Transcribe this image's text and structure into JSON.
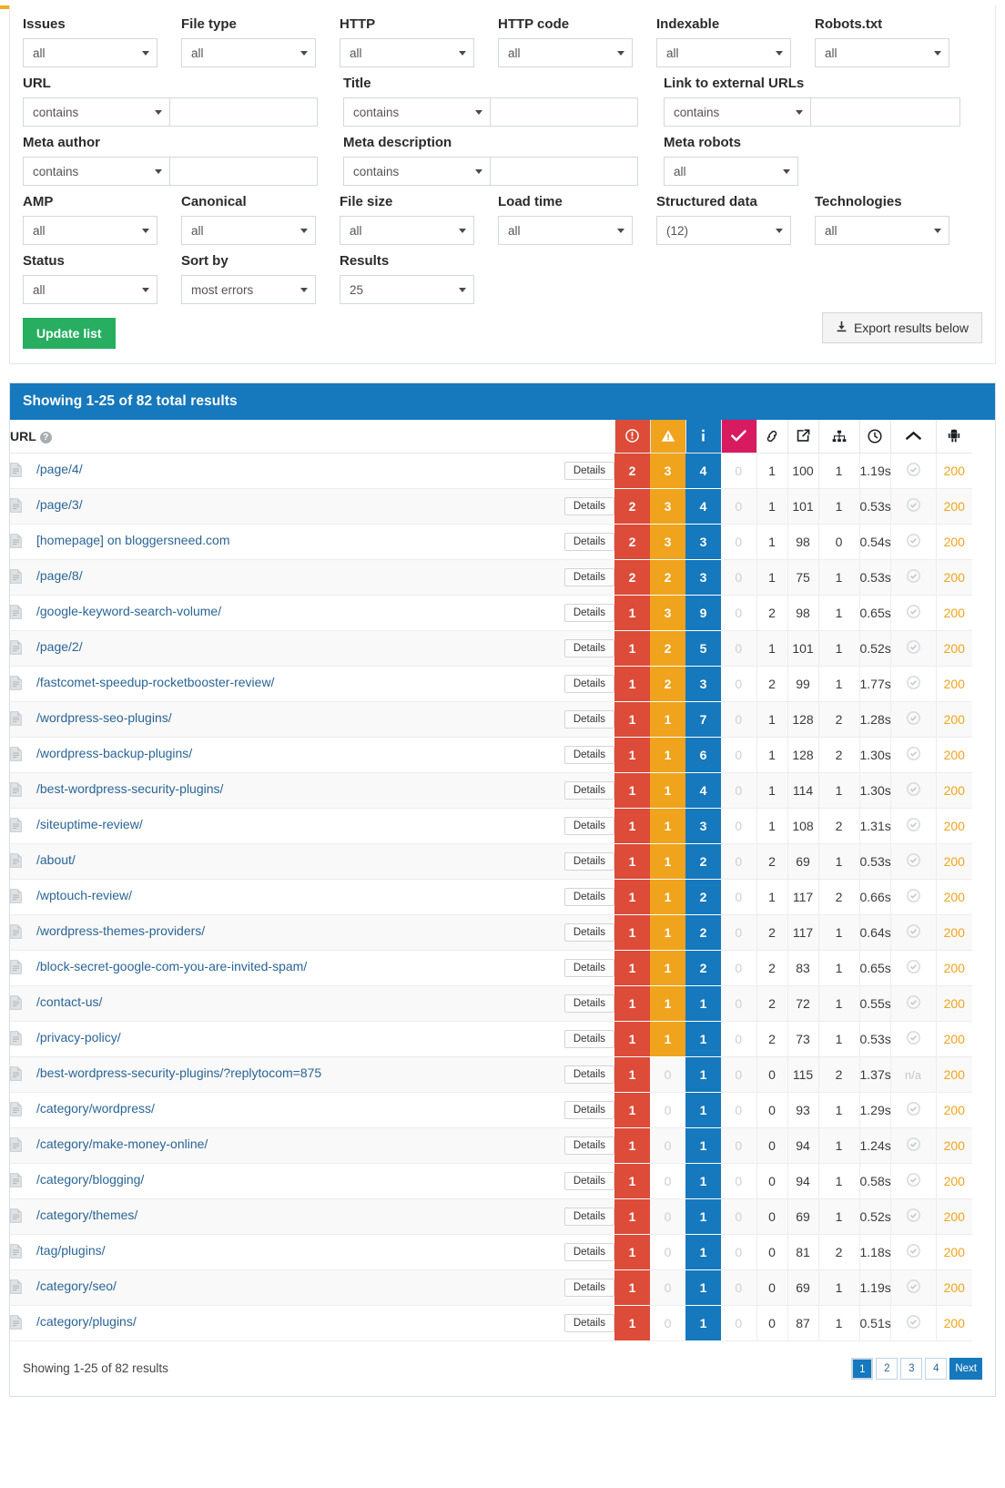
{
  "filters": {
    "row1": [
      {
        "label": "Issues",
        "value": "all",
        "name": "issues"
      },
      {
        "label": "File type",
        "value": "all",
        "name": "file-type"
      },
      {
        "label": "HTTP",
        "value": "all",
        "name": "http"
      },
      {
        "label": "HTTP code",
        "value": "all",
        "name": "http-code"
      },
      {
        "label": "Indexable",
        "value": "all",
        "name": "indexable"
      },
      {
        "label": "Robots.txt",
        "value": "all",
        "name": "robots-txt"
      }
    ],
    "row2": [
      {
        "label": "URL",
        "value": "contains",
        "text": "",
        "name": "url"
      },
      {
        "label": "Title",
        "value": "contains",
        "text": "",
        "name": "title"
      },
      {
        "label": "Link to external URLs",
        "value": "contains",
        "text": "",
        "name": "link-to-external-urls"
      }
    ],
    "row3": [
      {
        "label": "Meta author",
        "value": "contains",
        "text": "",
        "name": "meta-author"
      },
      {
        "label": "Meta description",
        "value": "contains",
        "text": "",
        "name": "meta-description"
      },
      {
        "label": "Meta robots",
        "value": "all",
        "name": "meta-robots"
      }
    ],
    "row4": [
      {
        "label": "AMP",
        "value": "all",
        "name": "amp"
      },
      {
        "label": "Canonical",
        "value": "all",
        "name": "canonical"
      },
      {
        "label": "File size",
        "value": "all",
        "name": "file-size"
      },
      {
        "label": "Load time",
        "value": "all",
        "name": "load-time"
      },
      {
        "label": "Structured data",
        "value": "(12)",
        "name": "structured-data"
      },
      {
        "label": "Technologies",
        "value": "all",
        "name": "technologies"
      }
    ],
    "row5": [
      {
        "label": "Status",
        "value": "all",
        "name": "status"
      },
      {
        "label": "Sort by",
        "value": "most errors",
        "name": "sort-by"
      },
      {
        "label": "Results",
        "value": "25",
        "name": "results"
      }
    ],
    "update_button": "Update list",
    "export_button": "Export results below"
  },
  "results": {
    "header": "Showing 1-25 of 82 total results",
    "url_column_label": "URL",
    "help_glyph": "?",
    "details_label": "Details",
    "columns": [
      {
        "icon": "error-icon",
        "class": "err"
      },
      {
        "icon": "warning-icon",
        "class": "warn"
      },
      {
        "icon": "info-icon",
        "class": "info"
      },
      {
        "icon": "check-icon",
        "class": "ok"
      },
      {
        "icon": "link-icon",
        "class": ""
      },
      {
        "icon": "external-link-icon",
        "class": ""
      },
      {
        "icon": "sitemap-icon",
        "class": ""
      },
      {
        "icon": "clock-icon",
        "class": ""
      },
      {
        "icon": "chevron-up-icon",
        "class": ""
      },
      {
        "icon": "robot-icon",
        "class": ""
      }
    ],
    "rows": [
      {
        "url": "/page/4/",
        "errors": 2,
        "warnings": 3,
        "info": 4,
        "ok": 0,
        "links": 1,
        "ext": 100,
        "depth": 1,
        "time": "1.19s",
        "indexable": "check",
        "status": "200"
      },
      {
        "url": "/page/3/",
        "errors": 2,
        "warnings": 3,
        "info": 4,
        "ok": 0,
        "links": 1,
        "ext": 101,
        "depth": 1,
        "time": "0.53s",
        "indexable": "check",
        "status": "200"
      },
      {
        "url": "[homepage] on bloggersneed.com",
        "errors": 2,
        "warnings": 3,
        "info": 3,
        "ok": 0,
        "links": 1,
        "ext": 98,
        "depth": 0,
        "time": "0.54s",
        "indexable": "check",
        "status": "200"
      },
      {
        "url": "/page/8/",
        "errors": 2,
        "warnings": 2,
        "info": 3,
        "ok": 0,
        "links": 1,
        "ext": 75,
        "depth": 1,
        "time": "0.53s",
        "indexable": "check",
        "status": "200"
      },
      {
        "url": "/google-keyword-search-volume/",
        "errors": 1,
        "warnings": 3,
        "info": 9,
        "ok": 0,
        "links": 2,
        "ext": 98,
        "depth": 1,
        "time": "0.65s",
        "indexable": "check",
        "status": "200"
      },
      {
        "url": "/page/2/",
        "errors": 1,
        "warnings": 2,
        "info": 5,
        "ok": 0,
        "links": 1,
        "ext": 101,
        "depth": 1,
        "time": "0.52s",
        "indexable": "check",
        "status": "200"
      },
      {
        "url": "/fastcomet-speedup-rocketbooster-review/",
        "errors": 1,
        "warnings": 2,
        "info": 3,
        "ok": 0,
        "links": 2,
        "ext": 99,
        "depth": 1,
        "time": "1.77s",
        "indexable": "check",
        "status": "200"
      },
      {
        "url": "/wordpress-seo-plugins/",
        "errors": 1,
        "warnings": 1,
        "info": 7,
        "ok": 0,
        "links": 1,
        "ext": 128,
        "depth": 2,
        "time": "1.28s",
        "indexable": "check",
        "status": "200"
      },
      {
        "url": "/wordpress-backup-plugins/",
        "errors": 1,
        "warnings": 1,
        "info": 6,
        "ok": 0,
        "links": 1,
        "ext": 128,
        "depth": 2,
        "time": "1.30s",
        "indexable": "check",
        "status": "200"
      },
      {
        "url": "/best-wordpress-security-plugins/",
        "errors": 1,
        "warnings": 1,
        "info": 4,
        "ok": 0,
        "links": 1,
        "ext": 114,
        "depth": 1,
        "time": "1.30s",
        "indexable": "check",
        "status": "200"
      },
      {
        "url": "/siteuptime-review/",
        "errors": 1,
        "warnings": 1,
        "info": 3,
        "ok": 0,
        "links": 1,
        "ext": 108,
        "depth": 2,
        "time": "1.31s",
        "indexable": "check",
        "status": "200"
      },
      {
        "url": "/about/",
        "errors": 1,
        "warnings": 1,
        "info": 2,
        "ok": 0,
        "links": 2,
        "ext": 69,
        "depth": 1,
        "time": "0.53s",
        "indexable": "check",
        "status": "200"
      },
      {
        "url": "/wptouch-review/",
        "errors": 1,
        "warnings": 1,
        "info": 2,
        "ok": 0,
        "links": 1,
        "ext": 117,
        "depth": 2,
        "time": "0.66s",
        "indexable": "check",
        "status": "200"
      },
      {
        "url": "/wordpress-themes-providers/",
        "errors": 1,
        "warnings": 1,
        "info": 2,
        "ok": 0,
        "links": 2,
        "ext": 117,
        "depth": 1,
        "time": "0.64s",
        "indexable": "check",
        "status": "200"
      },
      {
        "url": "/block-secret-google-com-you-are-invited-spam/",
        "errors": 1,
        "warnings": 1,
        "info": 2,
        "ok": 0,
        "links": 2,
        "ext": 83,
        "depth": 1,
        "time": "0.65s",
        "indexable": "check",
        "status": "200"
      },
      {
        "url": "/contact-us/",
        "errors": 1,
        "warnings": 1,
        "info": 1,
        "ok": 0,
        "links": 2,
        "ext": 72,
        "depth": 1,
        "time": "0.55s",
        "indexable": "check",
        "status": "200"
      },
      {
        "url": "/privacy-policy/",
        "errors": 1,
        "warnings": 1,
        "info": 1,
        "ok": 0,
        "links": 2,
        "ext": 73,
        "depth": 1,
        "time": "0.53s",
        "indexable": "check",
        "status": "200"
      },
      {
        "url": "/best-wordpress-security-plugins/?replytocom=875",
        "errors": 1,
        "warnings": 0,
        "info": 1,
        "ok": 0,
        "links": 0,
        "ext": 115,
        "depth": 2,
        "time": "1.37s",
        "indexable": "n/a",
        "status": "200"
      },
      {
        "url": "/category/wordpress/",
        "errors": 1,
        "warnings": 0,
        "info": 1,
        "ok": 0,
        "links": 0,
        "ext": 93,
        "depth": 1,
        "time": "1.29s",
        "indexable": "check",
        "status": "200"
      },
      {
        "url": "/category/make-money-online/",
        "errors": 1,
        "warnings": 0,
        "info": 1,
        "ok": 0,
        "links": 0,
        "ext": 94,
        "depth": 1,
        "time": "1.24s",
        "indexable": "check",
        "status": "200"
      },
      {
        "url": "/category/blogging/",
        "errors": 1,
        "warnings": 0,
        "info": 1,
        "ok": 0,
        "links": 0,
        "ext": 94,
        "depth": 1,
        "time": "0.58s",
        "indexable": "check",
        "status": "200"
      },
      {
        "url": "/category/themes/",
        "errors": 1,
        "warnings": 0,
        "info": 1,
        "ok": 0,
        "links": 0,
        "ext": 69,
        "depth": 1,
        "time": "0.52s",
        "indexable": "check",
        "status": "200"
      },
      {
        "url": "/tag/plugins/",
        "errors": 1,
        "warnings": 0,
        "info": 1,
        "ok": 0,
        "links": 0,
        "ext": 81,
        "depth": 2,
        "time": "1.18s",
        "indexable": "check",
        "status": "200"
      },
      {
        "url": "/category/seo/",
        "errors": 1,
        "warnings": 0,
        "info": 1,
        "ok": 0,
        "links": 0,
        "ext": 69,
        "depth": 1,
        "time": "1.19s",
        "indexable": "check",
        "status": "200"
      },
      {
        "url": "/category/plugins/",
        "errors": 1,
        "warnings": 0,
        "info": 1,
        "ok": 0,
        "links": 0,
        "ext": 87,
        "depth": 1,
        "time": "0.51s",
        "indexable": "check",
        "status": "200"
      }
    ],
    "footer_text": "Showing 1-25 of 82 results",
    "pages": [
      "1",
      "2",
      "3",
      "4"
    ],
    "next_label": "Next",
    "active_page": "1"
  },
  "colors": {
    "error": "#dd4b39",
    "warning": "#f0a31c",
    "info": "#1678bd",
    "ok": "#d81b60",
    "status": "#f0a31c",
    "primary": "#1678bd",
    "green": "#27ae60"
  }
}
